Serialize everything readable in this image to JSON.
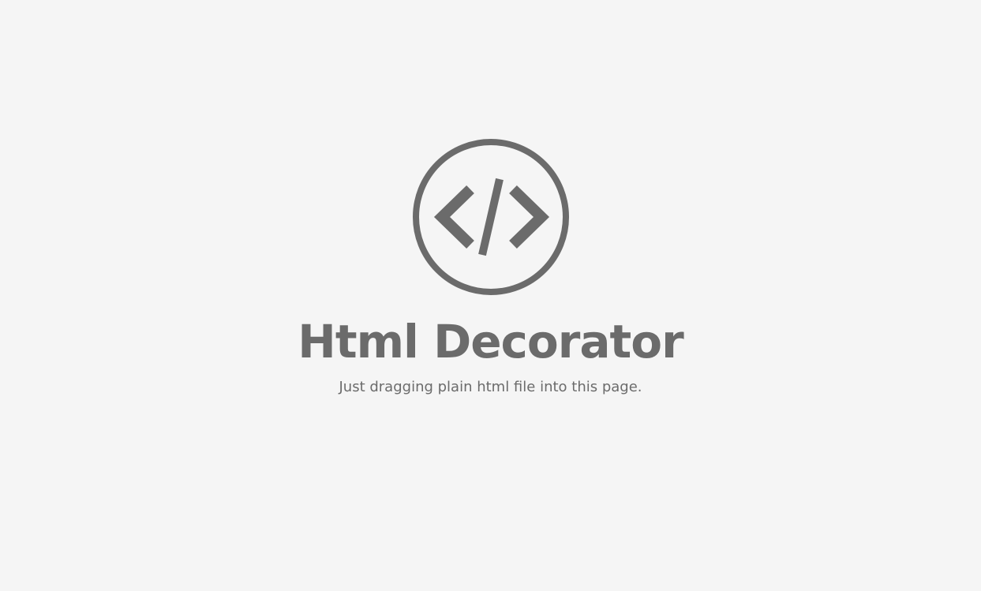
{
  "app": {
    "title": "Html Decorator",
    "subtitle": "Just dragging plain html file into this page.",
    "logo_icon": "code-brackets-icon"
  },
  "colors": {
    "background": "#f5f5f5",
    "foreground": "#6b6b6b"
  }
}
